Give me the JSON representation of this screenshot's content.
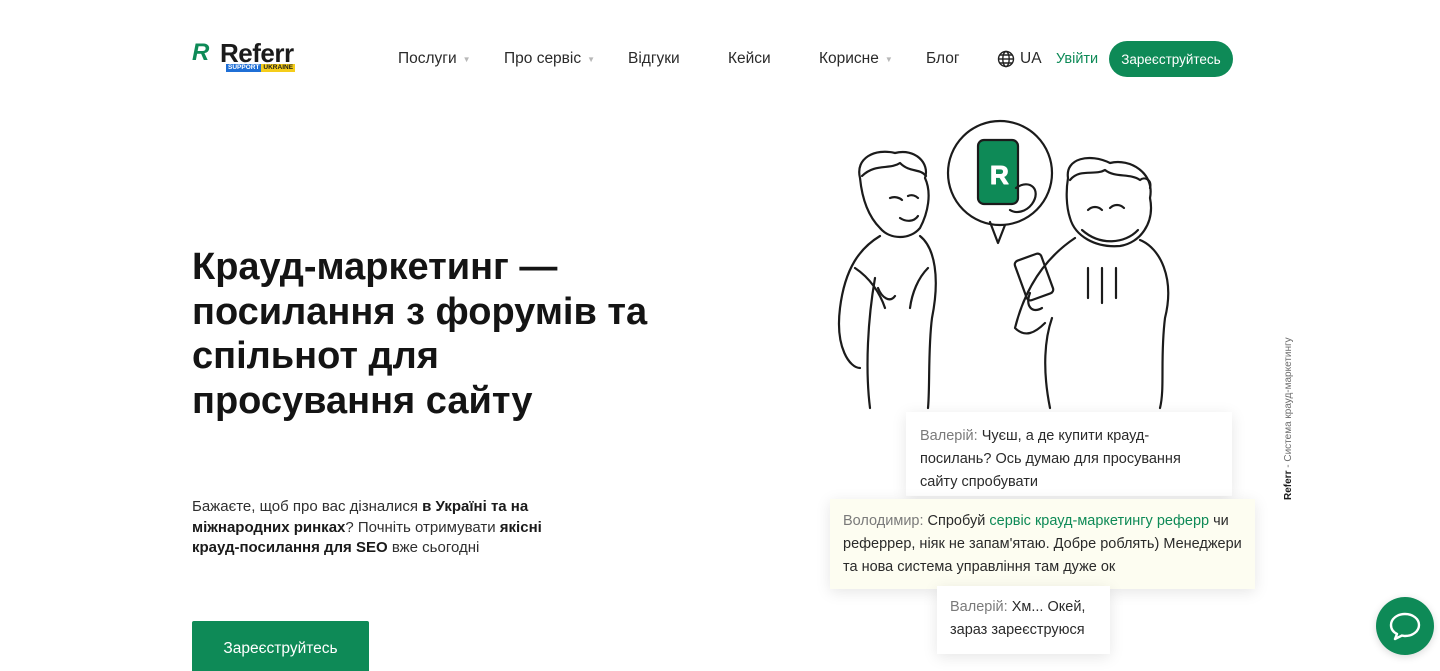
{
  "header": {
    "logo": {
      "brand": "Referr",
      "support": "SUPPORT",
      "ukraine": "UKRAINE"
    },
    "nav": [
      {
        "label": "Послуги",
        "dropdown": true
      },
      {
        "label": "Про сервіс",
        "dropdown": true
      },
      {
        "label": "Відгуки",
        "dropdown": false
      },
      {
        "label": "Кейси",
        "dropdown": false
      },
      {
        "label": "Корисне",
        "dropdown": true
      },
      {
        "label": "Блог",
        "dropdown": false
      }
    ],
    "lang": "UA",
    "login": "Увійти",
    "signup": "Зареєструйтесь"
  },
  "hero": {
    "title": "Крауд-маркетинг — посилання з форумів та спільнот для просування сайту",
    "desc": {
      "p1": "Бажаєте, щоб про вас дізналися ",
      "b1": "в Україні та на міжнародних ринках",
      "p2": "? Почніть отримувати ",
      "b2": "якісні крауд-посилання для SEO",
      "p3": " вже сьогодні"
    },
    "cta": "Зареєструйтесь"
  },
  "chat": {
    "m1": {
      "who": "Валерій:",
      "text": "Чуєш, а де купити крауд-посилань? Ось думаю для просування сайту спробувати"
    },
    "m2": {
      "who": "Володимир:",
      "t1": "Спробуй ",
      "link": "сервіс крауд-маркетингу реферр",
      "t2": " чи реферрер, ніяк не запам'ятаю. Добре роблять) Менеджери та нова система управління там дуже ок"
    },
    "m3": {
      "who": "Валерій:",
      "text": "Хм... Окей, зараз зареєструюся"
    }
  },
  "side": {
    "brand": "Referr",
    "text": " - Система крауд-маркетингу"
  },
  "colors": {
    "accent": "#0e8a57",
    "text": "#1f1f1f",
    "muted": "#7a7a7a",
    "blue": "#1f6fd6",
    "yellow": "#f5cd1a"
  },
  "icons": {
    "globe": "globe-icon",
    "chat": "chat-bubble-icon",
    "caret": "caret-down-icon"
  }
}
